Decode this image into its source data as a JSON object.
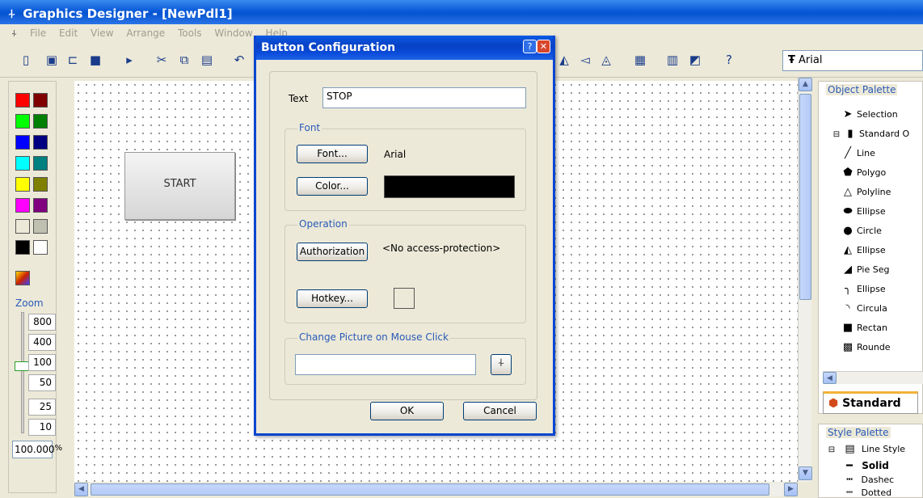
{
  "window": {
    "title": "Graphics Designer - [NewPdl1]"
  },
  "menu": [
    "File",
    "Edit",
    "View",
    "Arrange",
    "Tools",
    "Window",
    "Help"
  ],
  "toolbar": {
    "font_name": "Arial"
  },
  "left_panel": {
    "colors": [
      "#ff0000",
      "#800000",
      "#00ff00",
      "#008000",
      "#0000ff",
      "#000080",
      "#00ffff",
      "#008080",
      "#ffff00",
      "#808000",
      "#ff00ff",
      "#800080",
      "#ece9d8",
      "#c0c0b0",
      "#000000",
      "#ffffff"
    ],
    "zoom_label": "Zoom",
    "zoom_ticks": [
      "800",
      "400",
      "100",
      "50",
      "25",
      "10"
    ],
    "zoom_value": "100.000",
    "zoom_unit": "%"
  },
  "canvas": {
    "start_button_text": "START"
  },
  "object_palette": {
    "title": "Object Palette",
    "items": [
      {
        "label": "Selection",
        "icon": "arrow-icon"
      },
      {
        "label": "Standard O",
        "icon": "folder-icon"
      },
      {
        "label": "Line",
        "icon": "line-icon"
      },
      {
        "label": "Polygo",
        "icon": "polygon-icon"
      },
      {
        "label": "Polyline",
        "icon": "polyline-icon"
      },
      {
        "label": "Ellipse",
        "icon": "ellipse-icon"
      },
      {
        "label": "Circle",
        "icon": "circle-icon"
      },
      {
        "label": "Ellipse",
        "icon": "ellipse-segment-icon"
      },
      {
        "label": "Pie Seg",
        "icon": "pie-segment-icon"
      },
      {
        "label": "Ellipse",
        "icon": "ellipse-arc-icon"
      },
      {
        "label": "Circula",
        "icon": "circular-arc-icon"
      },
      {
        "label": "Rectan",
        "icon": "rectangle-icon"
      },
      {
        "label": "Rounde",
        "icon": "rounded-rect-icon"
      }
    ],
    "tab_label": "Standard"
  },
  "style_palette": {
    "title": "Style Palette",
    "items": [
      "Line Style",
      "Solid",
      "Dashec",
      "Dotted"
    ]
  },
  "dialog": {
    "title": "Button Configuration",
    "help": "?",
    "close": "✕",
    "text_label": "Text",
    "text_value": "STOP",
    "font_group": "Font",
    "font_button": "Font...",
    "font_value": "Arial",
    "color_button": "Color...",
    "color_value": "#000000",
    "operation_group": "Operation",
    "authorization_button": "Authorization",
    "authorization_value": "<No access-protection>",
    "hotkey_button": "Hotkey...",
    "picture_group": "Change Picture on Mouse Click",
    "picture_value": "",
    "ok": "OK",
    "cancel": "Cancel"
  }
}
